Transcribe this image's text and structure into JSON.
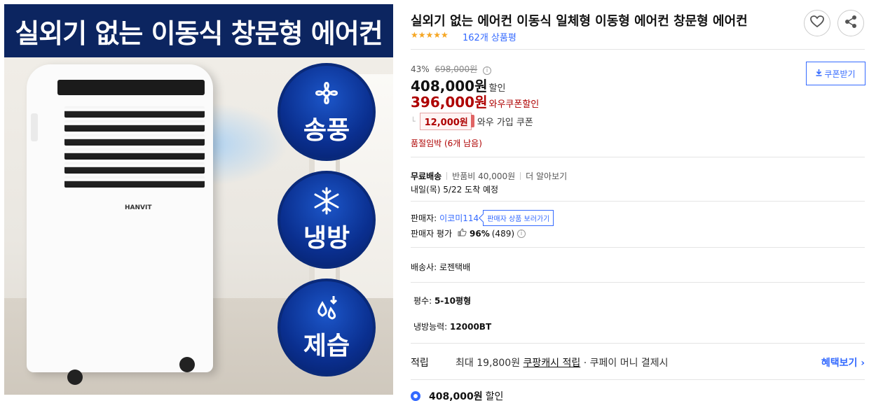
{
  "image": {
    "banner": "실외기 없는 이동식 창문형 에어컨",
    "brand": "HANVIT",
    "badges": [
      {
        "icon": "fan-icon",
        "label": "송풍"
      },
      {
        "icon": "snowflake-icon",
        "label": "냉방"
      },
      {
        "icon": "droplet-icon",
        "label": "제습"
      }
    ]
  },
  "product": {
    "title": "실외기 없는 에어컨 이동식 일체형 이동형 에어컨 창문형 에어컨",
    "stars": "★★★★★",
    "review_count": "162개 상품평"
  },
  "pricing": {
    "discount_rate": "43%",
    "original_price": "698,000원",
    "price": "408,000원",
    "price_suffix": "할인",
    "wow_price": "396,000원",
    "wow_suffix": "와우쿠폰할인",
    "coupon_amount": "12,000원",
    "coupon_label": "와우 가입 쿠폰",
    "low_stock": "품절임박 (6개 남음)",
    "coupon_button": "쿠폰받기"
  },
  "shipping": {
    "free": "무료배송",
    "return_fee": "반품비 40,000원",
    "more": "더 알아보기",
    "arrival": "내일(목) 5/22 도착 예정"
  },
  "seller": {
    "label": "판매자:",
    "name": "이코미114",
    "tooltip": "판매자 상품 보러가기",
    "rating_label": "판매자 평가",
    "rating_value": "96%",
    "rating_count": "(489)"
  },
  "courier": "배송사: 로젠택배",
  "attributes": [
    {
      "label": "평수:",
      "value": "5-10평형"
    },
    {
      "label": "냉방능력:",
      "value": "12000BT"
    }
  ],
  "cash": {
    "label": "적립",
    "prefix": "최대 19,800원 ",
    "link": "쿠팡캐시 적립",
    "suffix": " · 쿠페이 머니 결제시",
    "more": "혜택보기 ›"
  },
  "option": {
    "price": "408,000원",
    "suffix": "할인"
  },
  "colors": {
    "accent": "#346aff",
    "sale": "#ae0000",
    "banner": "#0c2560"
  }
}
